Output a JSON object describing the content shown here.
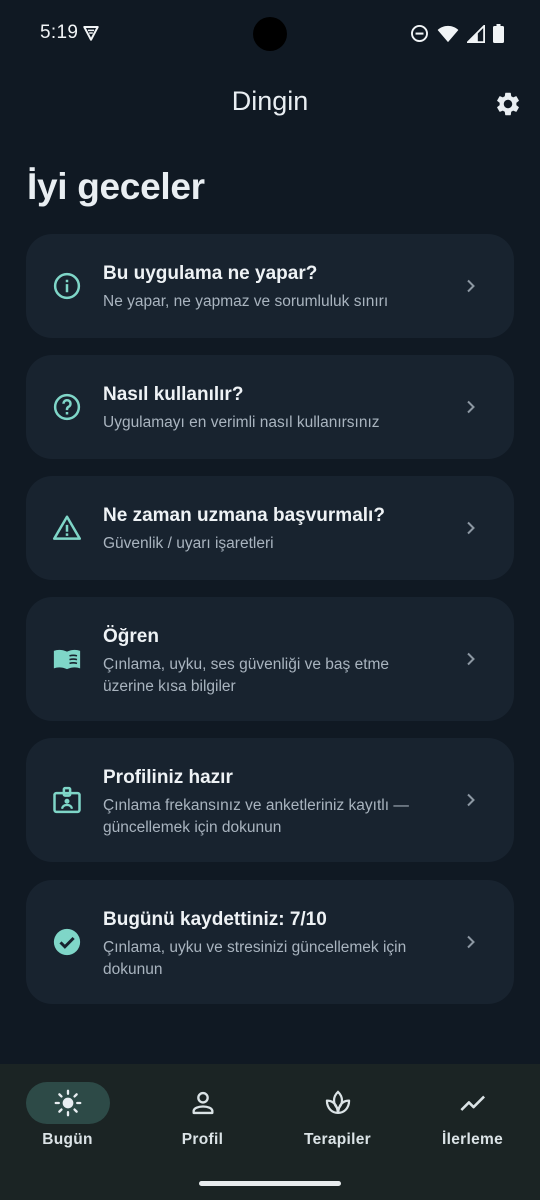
{
  "status_bar": {
    "time": "5:19",
    "icons": [
      "vpn-key-icon",
      "do-not-disturb-icon",
      "wifi-icon",
      "cell-signal-icon",
      "battery-icon"
    ]
  },
  "app_bar": {
    "title": "Dingin",
    "settings_icon": "gear-icon"
  },
  "greeting": "İyi geceler",
  "cards": [
    {
      "icon": "info-icon",
      "title": "Bu uygulama ne yapar?",
      "subtitle": "Ne yapar, ne yapmaz ve sorumluluk sınırı"
    },
    {
      "icon": "help-icon",
      "title": "Nasıl kullanılır?",
      "subtitle": "Uygulamayı en verimli nasıl kullanırsınız"
    },
    {
      "icon": "warning-icon",
      "title": "Ne zaman uzmana başvurmalı?",
      "subtitle": "Güvenlik / uyarı işaretleri"
    },
    {
      "icon": "book-icon",
      "title": "Öğren",
      "subtitle": "Çınlama, uyku, ses güvenliği ve baş etme üzerine kısa bilgiler"
    },
    {
      "icon": "id-badge-icon",
      "title": "Profiliniz hazır",
      "subtitle": "Çınlama frekansınız ve anketleriniz kayıtlı — güncellemek için dokunun"
    },
    {
      "icon": "check-circle-icon",
      "title": "Bugünü kaydettiniz: 7/10",
      "subtitle": "Çınlama, uyku ve stresinizi güncellemek için dokunun"
    }
  ],
  "bottom_nav": {
    "items": [
      {
        "label": "Bugün",
        "icon": "sun-icon",
        "active": true
      },
      {
        "label": "Profil",
        "icon": "person-icon",
        "active": false
      },
      {
        "label": "Terapiler",
        "icon": "spa-icon",
        "active": false
      },
      {
        "label": "İlerleme",
        "icon": "trending-up-icon",
        "active": false
      }
    ]
  },
  "colors": {
    "background": "#101923",
    "card": "#18232f",
    "accent": "#7fd6c8",
    "nav_background": "#1b2424",
    "nav_active_pill": "#2d4a47"
  }
}
